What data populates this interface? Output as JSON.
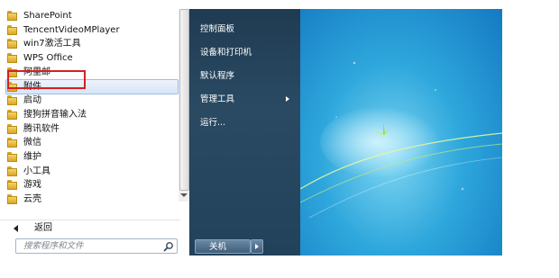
{
  "program_list": [
    {
      "label": "SharePoint"
    },
    {
      "label": "TencentVideoMPlayer"
    },
    {
      "label": "win7激活工具"
    },
    {
      "label": "WPS Office"
    },
    {
      "label": "阿里邮"
    },
    {
      "label": "附件",
      "selected": true
    },
    {
      "label": "启动"
    },
    {
      "label": "搜狗拼音输入法"
    },
    {
      "label": "腾讯软件"
    },
    {
      "label": "微信"
    },
    {
      "label": "维护"
    },
    {
      "label": "小工具"
    },
    {
      "label": "游戏"
    },
    {
      "label": "云壳"
    }
  ],
  "back_label": "返回",
  "search_placeholder": "搜索程序和文件",
  "right_menu": [
    {
      "label": "控制面板"
    },
    {
      "label": "设备和打印机"
    },
    {
      "label": "默认程序"
    },
    {
      "label": "管理工具",
      "has_submenu": true
    },
    {
      "label": "运行..."
    }
  ],
  "shutdown_label": "关机",
  "colors": {
    "highlight_border": "#d42025",
    "selection_border": "#9fbde3",
    "right_panel": "#22415a",
    "desktop": "#2ea7dc"
  },
  "icons": [
    "folder-icon",
    "back-arrow-icon",
    "search-icon",
    "submenu-arrow-icon",
    "shutdown-options-arrow-icon"
  ]
}
